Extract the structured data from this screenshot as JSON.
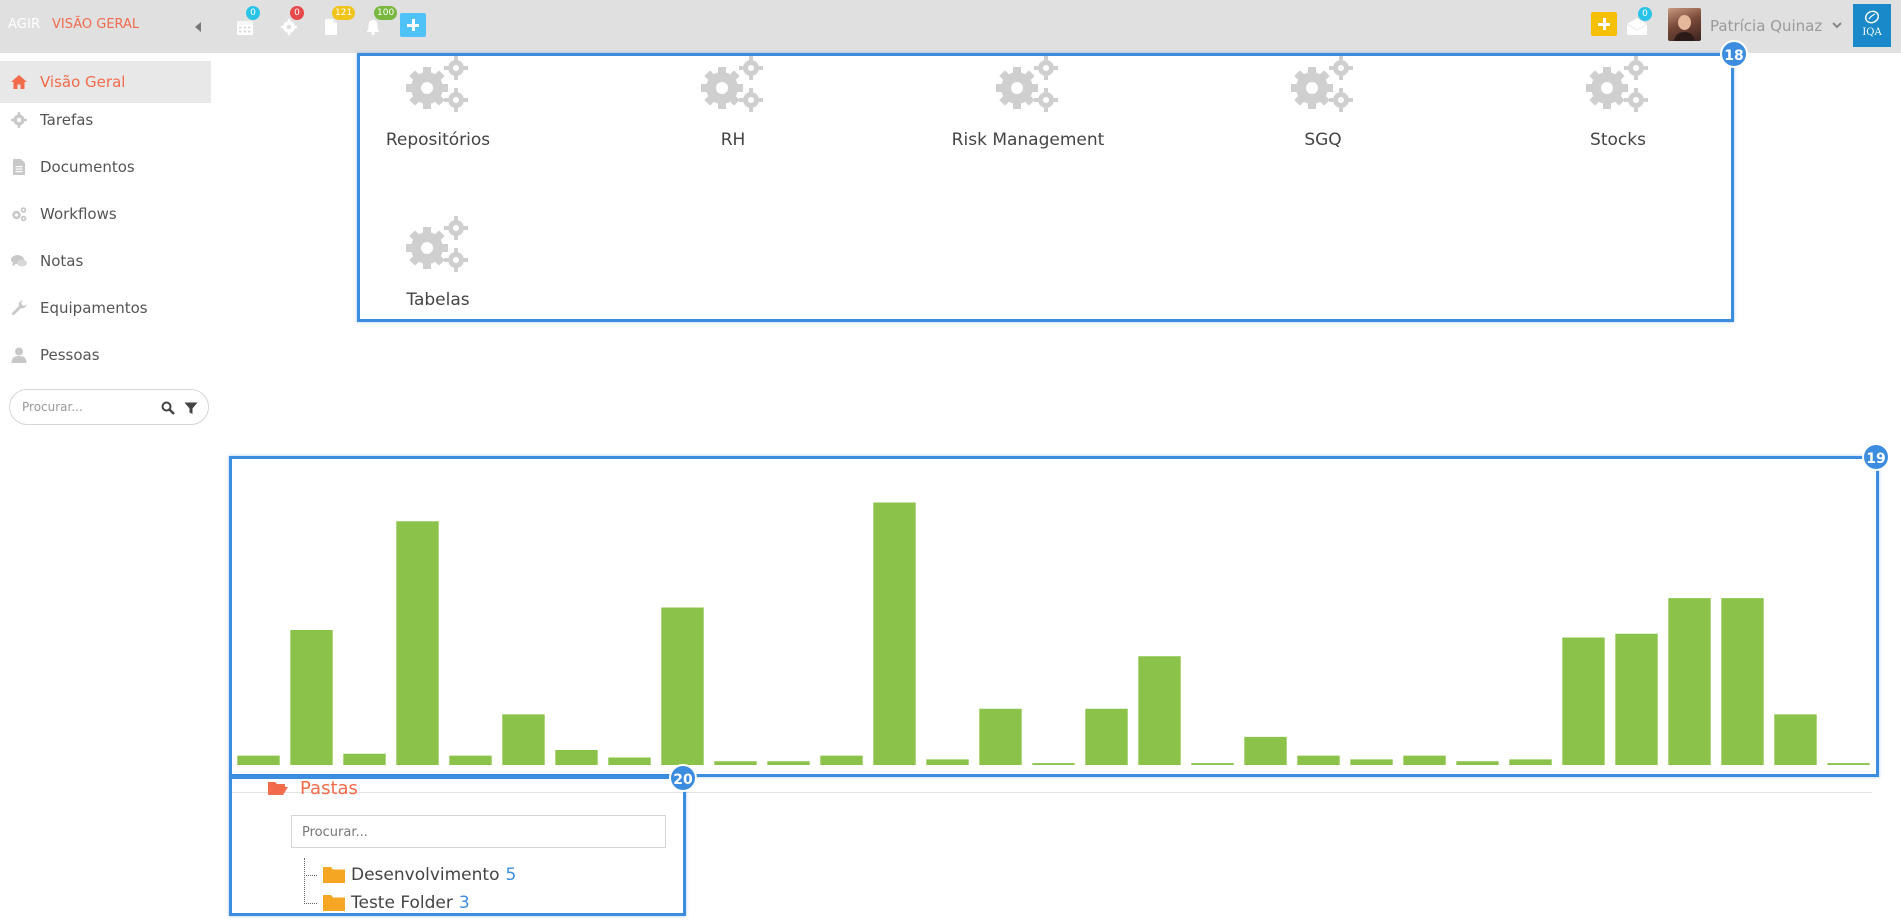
{
  "header": {
    "brand": "AGIR",
    "breadcrumb": "VISÃO GERAL",
    "badges": [
      {
        "icon": "calendar-icon",
        "count": "0",
        "color": "#29c3e8"
      },
      {
        "icon": "gear-icon",
        "count": "0",
        "color": "#e84a4a"
      },
      {
        "icon": "document-icon",
        "count": "121",
        "color": "#f0c419"
      },
      {
        "icon": "bell-icon",
        "count": "100",
        "color": "#78b83f"
      }
    ],
    "mail_count": "0",
    "user_name": "Patrícia Quinaz",
    "logo_text": "IQA"
  },
  "sidebar": {
    "items": [
      {
        "label": "Visão Geral",
        "icon": "home-icon"
      },
      {
        "label": "Tarefas",
        "icon": "gear-icon"
      },
      {
        "label": "Documentos",
        "icon": "file-icon"
      },
      {
        "label": "Workflows",
        "icon": "gears-icon"
      },
      {
        "label": "Notas",
        "icon": "comments-icon"
      },
      {
        "label": "Equipamentos",
        "icon": "wrench-icon"
      },
      {
        "label": "Pessoas",
        "icon": "user-icon"
      }
    ],
    "search_placeholder": "Procurar..."
  },
  "overlays": {
    "apps_badge": "18",
    "chart_badge": "19",
    "folders_badge": "20"
  },
  "apps": [
    {
      "label": "Repositórios",
      "icon": "gears-icon"
    },
    {
      "label": "RH",
      "icon": "gears-icon"
    },
    {
      "label": "Risk Management",
      "icon": "gears-icon"
    },
    {
      "label": "SGQ",
      "icon": "gears-icon"
    },
    {
      "label": "Stocks",
      "icon": "gears-icon"
    },
    {
      "label": "Tabelas",
      "icon": "gears-icon"
    }
  ],
  "chart_data": {
    "type": "bar",
    "color": "#8bc34a",
    "values": [
      2.5,
      36,
      3,
      65,
      2.5,
      13.5,
      4,
      2,
      42,
      1,
      1,
      2.5,
      70,
      1.5,
      15,
      0.5,
      15,
      29,
      0.5,
      7.5,
      2.5,
      1.5,
      2.5,
      1,
      1.5,
      34,
      35,
      44.5,
      44.5,
      13.5,
      0.5
    ],
    "ylim": [
      0,
      72
    ],
    "grid": false
  },
  "folders": {
    "title": "Pastas",
    "search_placeholder": "Procurar...",
    "items": [
      {
        "name": "Desenvolvimento",
        "count": "5"
      },
      {
        "name": "Teste Folder",
        "count": "3"
      }
    ]
  }
}
